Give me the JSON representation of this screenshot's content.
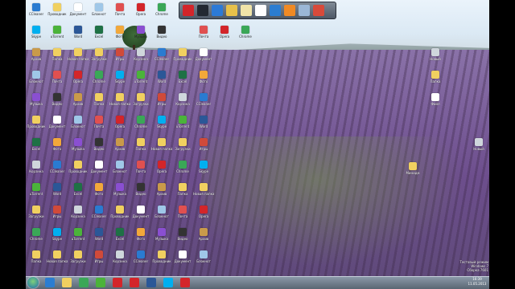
{
  "wallpaper": "lavender-field",
  "toolbar": {
    "items": [
      {
        "name": "opera-icon",
        "color": "#d3252a"
      },
      {
        "name": "monitor-icon",
        "color": "#222831"
      },
      {
        "name": "window-icon",
        "color": "#2c7ad6"
      },
      {
        "name": "pencil-icon",
        "color": "#e7c14a"
      },
      {
        "name": "edit-icon",
        "color": "#f0e4a8"
      },
      {
        "name": "document-icon",
        "color": "#ffffff"
      },
      {
        "name": "globe-icon",
        "color": "#2b7dd1"
      },
      {
        "name": "media-player-icon",
        "color": "#f08a24"
      },
      {
        "name": "settings-icon",
        "color": "#9bb7d6"
      },
      {
        "name": "eject-icon",
        "color": "#d84a3a"
      }
    ]
  },
  "desktop_icons": [
    {
      "label": "CCleaner",
      "color": "#2a7bd1"
    },
    {
      "label": "Проводник",
      "color": "#f0d060"
    },
    {
      "label": "Документ",
      "color": "#ffffff"
    },
    {
      "label": "Блокнот",
      "color": "#9fc7e8"
    },
    {
      "label": "Почта",
      "color": "#e05050"
    },
    {
      "label": "Opera",
      "color": "#d3252a"
    },
    {
      "label": "Chrome",
      "color": "#3aa757"
    },
    {
      "label": "Skype",
      "color": "#00aff0"
    },
    {
      "label": "uTorrent",
      "color": "#4bb33a"
    },
    {
      "label": "Word",
      "color": "#2b5797"
    },
    {
      "label": "Excel",
      "color": "#1e7145"
    },
    {
      "label": "Фото",
      "color": "#f2a83a"
    },
    {
      "label": "Музыка",
      "color": "#8a4fd1"
    },
    {
      "label": "Видео",
      "color": "#333333"
    },
    {
      "label": "Архив",
      "color": "#c99a4a"
    },
    {
      "label": "Папка",
      "color": "#f0d060"
    },
    {
      "label": "Новая папка",
      "color": "#f0d060"
    },
    {
      "label": "Загрузки",
      "color": "#f0d060"
    },
    {
      "label": "Игры",
      "color": "#d04a3a"
    },
    {
      "label": "Корзина",
      "color": "#cfd6dc"
    }
  ],
  "right_icons": [
    {
      "label": "Новый",
      "color": "#cfd6dc"
    },
    {
      "label": "Папка",
      "color": "#f0d060"
    },
    {
      "label": "Файл",
      "color": "#ffffff"
    }
  ],
  "middle_icon": {
    "label": "Минидм",
    "color": "#f0d060"
  },
  "taskbar": {
    "buttons": [
      {
        "name": "ie-icon",
        "color": "#2b7dd1"
      },
      {
        "name": "folder-icon",
        "color": "#f0d060"
      },
      {
        "name": "chrome-icon",
        "color": "#3aa757"
      },
      {
        "name": "utorrent-icon",
        "color": "#4bb33a"
      },
      {
        "name": "opera-icon",
        "color": "#d3252a"
      },
      {
        "name": "opera-icon",
        "color": "#d3252a"
      },
      {
        "name": "word-icon",
        "color": "#2b5797"
      },
      {
        "name": "skype-icon",
        "color": "#00aff0"
      },
      {
        "name": "record-icon",
        "color": "#d3252a"
      }
    ],
    "clock_time": "16:39",
    "clock_date": "11.05.2013"
  },
  "watermark": {
    "line1": "Тестовый режим",
    "line2": "Windows 7",
    "line3": "Сборка 7601"
  }
}
